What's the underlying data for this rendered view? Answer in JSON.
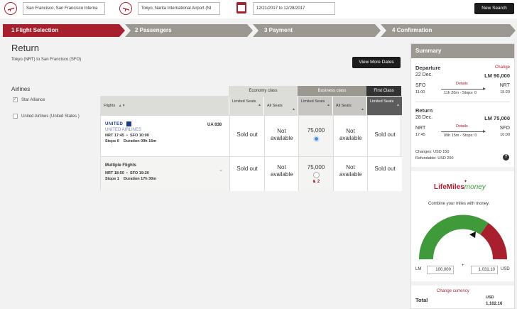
{
  "search": {
    "origin_value": "San Francisco, San Francisco Interna",
    "destination_value": "Tokyo, Narita International Airport (NI",
    "dates_value": "12/21/2017 to 12/28/2017",
    "new_search_label": "New Search"
  },
  "steps": [
    {
      "label": "1 Flight Selection",
      "active": true
    },
    {
      "label": "2 Passengers",
      "active": false
    },
    {
      "label": "3 Payment",
      "active": false
    },
    {
      "label": "4 Confirmation",
      "active": false
    }
  ],
  "page": {
    "title": "Return",
    "route": "Tokyo (NRT) to San Francisco (SFO)",
    "view_more_dates": "View More Dates"
  },
  "filters": {
    "heading": "Airlines",
    "items": [
      {
        "label": "Star Alliance",
        "checked": true
      },
      {
        "label": "United Airlines (United States )",
        "checked": false
      }
    ]
  },
  "classes": {
    "economy": "Economy class",
    "business": "Business class",
    "first": "First Class"
  },
  "columns": {
    "flights": "Flights",
    "limited_seats": "Limited Seats",
    "all_seats": "All Seats"
  },
  "flights": [
    {
      "airline_logo": "UNITED",
      "airline_name": "UNITED AIRLINES",
      "flight_no": "UA 838",
      "dep": "NRT 17:45",
      "arr": "SFO 10:00",
      "stops": "Stops 0",
      "duration": "Duration 09h 15m",
      "econ_limited": "Sold out",
      "econ_all": "Not available",
      "biz_limited": "75,000",
      "biz_all": "Not available",
      "first_limited": "Sold out",
      "selected": true
    },
    {
      "title": "Multiple Flights",
      "dep": "NRT 18:50",
      "arr": "SFO 19:20",
      "stops": "Stops 1",
      "duration": "Duration 17h 30m",
      "econ_limited": "Sold out",
      "econ_all": "Not available",
      "biz_limited": "75,000",
      "biz_all": "Not available",
      "first_limited": "Sold out",
      "seat_count": "2",
      "selected": false
    }
  ],
  "summary": {
    "header": "Summary",
    "departure": {
      "label": "Departure",
      "date": "22 Dec.",
      "miles": "LM 90,000",
      "change": "Change",
      "from": "SFO",
      "to": "NRT",
      "dep_time": "11:00",
      "arr_time": "15:20",
      "details": "Details",
      "info": "11h 20m - Stops: 0"
    },
    "return": {
      "label": "Return",
      "date": "28 Dec.",
      "miles": "LM 75,000",
      "from": "NRT",
      "to": "SFO",
      "dep_time": "17:45",
      "arr_time": "10:00",
      "details": "Details",
      "info": "09h 15m - Stops: 0"
    },
    "changes": "Changes: USD 150",
    "refundable": "Refundable: USD 200",
    "brand": "LifeMiles",
    "brand_suffix": "money",
    "combine_text": "Combine your miles with money.",
    "lm_label": "LM",
    "lm_value": "100,000",
    "plus": "+",
    "usd_value": "1,031.10",
    "usd_label": "USD",
    "change_currency": "Change currency",
    "total_label": "Total",
    "total_currency": "USD",
    "total_value": "1,102.16"
  },
  "colors": {
    "brand_red": "#a8202d",
    "gauge_green": "#3f9a3a",
    "gauge_red": "#a8202d",
    "step_inactive": "#9b9791"
  }
}
